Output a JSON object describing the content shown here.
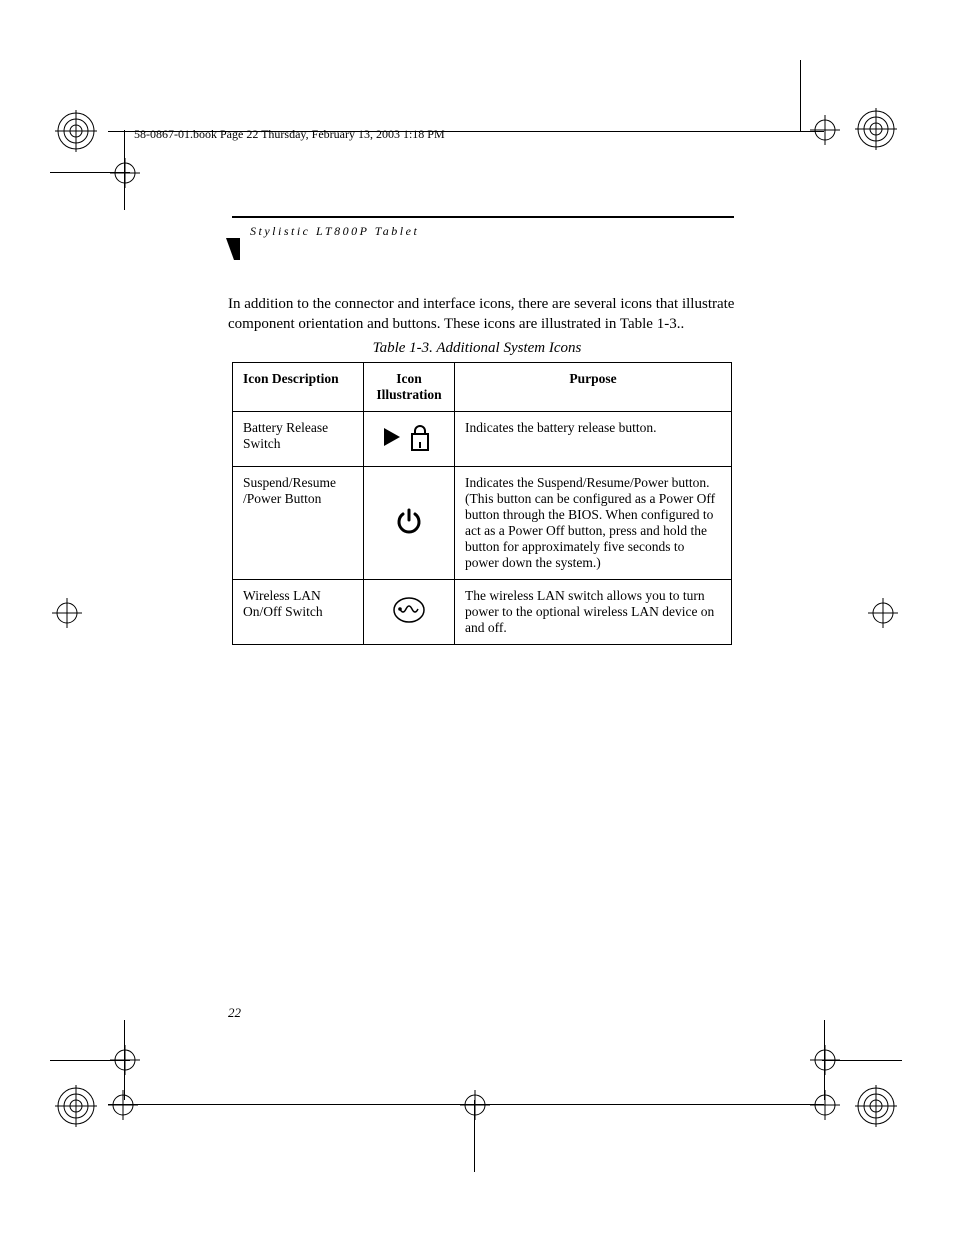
{
  "header_line": "58-0867-01.book  Page 22  Thursday, February 13, 2003  1:18 PM",
  "running_head": "Stylistic LT800P Tablet",
  "intro_text": "In addition to the connector and interface icons, there are several icons that illustrate component orientation and buttons. These icons are illustrated in Table 1-3..",
  "table_caption": "Table 1-3.   Additional System Icons",
  "headers": {
    "c1": "Icon Description",
    "c2": "Icon Illustration",
    "c3": "Purpose"
  },
  "rows": [
    {
      "desc": "Battery Release Switch",
      "purpose": "Indicates the battery release button."
    },
    {
      "desc": "Suspend/Resume /Power Button",
      "purpose": "Indicates the Suspend/Resume/Power button. (This button can be configured as a Power Off button through the BIOS. When configured to act as a Power Off button, press and hold the button for approximately five seconds to power down the system.)"
    },
    {
      "desc": "Wireless LAN On/Off Switch",
      "purpose": "The wireless LAN switch allows you to turn power to the optional wireless LAN device on and off."
    }
  ],
  "page_number": "22"
}
